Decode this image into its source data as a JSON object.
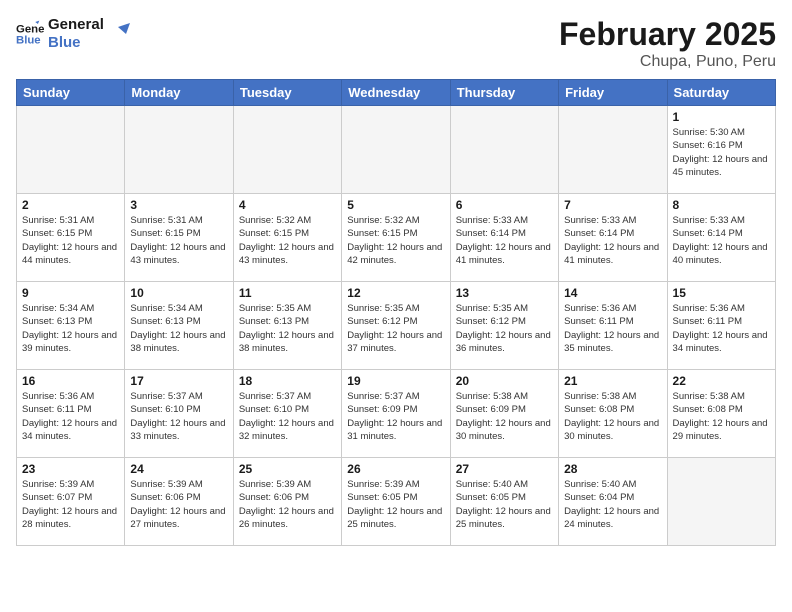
{
  "header": {
    "logo_line1": "General",
    "logo_line2": "Blue",
    "title": "February 2025",
    "subtitle": "Chupa, Puno, Peru"
  },
  "days_of_week": [
    "Sunday",
    "Monday",
    "Tuesday",
    "Wednesday",
    "Thursday",
    "Friday",
    "Saturday"
  ],
  "weeks": [
    [
      {
        "day": null,
        "info": null
      },
      {
        "day": null,
        "info": null
      },
      {
        "day": null,
        "info": null
      },
      {
        "day": null,
        "info": null
      },
      {
        "day": null,
        "info": null
      },
      {
        "day": null,
        "info": null
      },
      {
        "day": "1",
        "info": "Sunrise: 5:30 AM\nSunset: 6:16 PM\nDaylight: 12 hours\nand 45 minutes."
      }
    ],
    [
      {
        "day": "2",
        "info": "Sunrise: 5:31 AM\nSunset: 6:15 PM\nDaylight: 12 hours\nand 44 minutes."
      },
      {
        "day": "3",
        "info": "Sunrise: 5:31 AM\nSunset: 6:15 PM\nDaylight: 12 hours\nand 43 minutes."
      },
      {
        "day": "4",
        "info": "Sunrise: 5:32 AM\nSunset: 6:15 PM\nDaylight: 12 hours\nand 43 minutes."
      },
      {
        "day": "5",
        "info": "Sunrise: 5:32 AM\nSunset: 6:15 PM\nDaylight: 12 hours\nand 42 minutes."
      },
      {
        "day": "6",
        "info": "Sunrise: 5:33 AM\nSunset: 6:14 PM\nDaylight: 12 hours\nand 41 minutes."
      },
      {
        "day": "7",
        "info": "Sunrise: 5:33 AM\nSunset: 6:14 PM\nDaylight: 12 hours\nand 41 minutes."
      },
      {
        "day": "8",
        "info": "Sunrise: 5:33 AM\nSunset: 6:14 PM\nDaylight: 12 hours\nand 40 minutes."
      }
    ],
    [
      {
        "day": "9",
        "info": "Sunrise: 5:34 AM\nSunset: 6:13 PM\nDaylight: 12 hours\nand 39 minutes."
      },
      {
        "day": "10",
        "info": "Sunrise: 5:34 AM\nSunset: 6:13 PM\nDaylight: 12 hours\nand 38 minutes."
      },
      {
        "day": "11",
        "info": "Sunrise: 5:35 AM\nSunset: 6:13 PM\nDaylight: 12 hours\nand 38 minutes."
      },
      {
        "day": "12",
        "info": "Sunrise: 5:35 AM\nSunset: 6:12 PM\nDaylight: 12 hours\nand 37 minutes."
      },
      {
        "day": "13",
        "info": "Sunrise: 5:35 AM\nSunset: 6:12 PM\nDaylight: 12 hours\nand 36 minutes."
      },
      {
        "day": "14",
        "info": "Sunrise: 5:36 AM\nSunset: 6:11 PM\nDaylight: 12 hours\nand 35 minutes."
      },
      {
        "day": "15",
        "info": "Sunrise: 5:36 AM\nSunset: 6:11 PM\nDaylight: 12 hours\nand 34 minutes."
      }
    ],
    [
      {
        "day": "16",
        "info": "Sunrise: 5:36 AM\nSunset: 6:11 PM\nDaylight: 12 hours\nand 34 minutes."
      },
      {
        "day": "17",
        "info": "Sunrise: 5:37 AM\nSunset: 6:10 PM\nDaylight: 12 hours\nand 33 minutes."
      },
      {
        "day": "18",
        "info": "Sunrise: 5:37 AM\nSunset: 6:10 PM\nDaylight: 12 hours\nand 32 minutes."
      },
      {
        "day": "19",
        "info": "Sunrise: 5:37 AM\nSunset: 6:09 PM\nDaylight: 12 hours\nand 31 minutes."
      },
      {
        "day": "20",
        "info": "Sunrise: 5:38 AM\nSunset: 6:09 PM\nDaylight: 12 hours\nand 30 minutes."
      },
      {
        "day": "21",
        "info": "Sunrise: 5:38 AM\nSunset: 6:08 PM\nDaylight: 12 hours\nand 30 minutes."
      },
      {
        "day": "22",
        "info": "Sunrise: 5:38 AM\nSunset: 6:08 PM\nDaylight: 12 hours\nand 29 minutes."
      }
    ],
    [
      {
        "day": "23",
        "info": "Sunrise: 5:39 AM\nSunset: 6:07 PM\nDaylight: 12 hours\nand 28 minutes."
      },
      {
        "day": "24",
        "info": "Sunrise: 5:39 AM\nSunset: 6:06 PM\nDaylight: 12 hours\nand 27 minutes."
      },
      {
        "day": "25",
        "info": "Sunrise: 5:39 AM\nSunset: 6:06 PM\nDaylight: 12 hours\nand 26 minutes."
      },
      {
        "day": "26",
        "info": "Sunrise: 5:39 AM\nSunset: 6:05 PM\nDaylight: 12 hours\nand 25 minutes."
      },
      {
        "day": "27",
        "info": "Sunrise: 5:40 AM\nSunset: 6:05 PM\nDaylight: 12 hours\nand 25 minutes."
      },
      {
        "day": "28",
        "info": "Sunrise: 5:40 AM\nSunset: 6:04 PM\nDaylight: 12 hours\nand 24 minutes."
      },
      {
        "day": null,
        "info": null
      }
    ]
  ]
}
